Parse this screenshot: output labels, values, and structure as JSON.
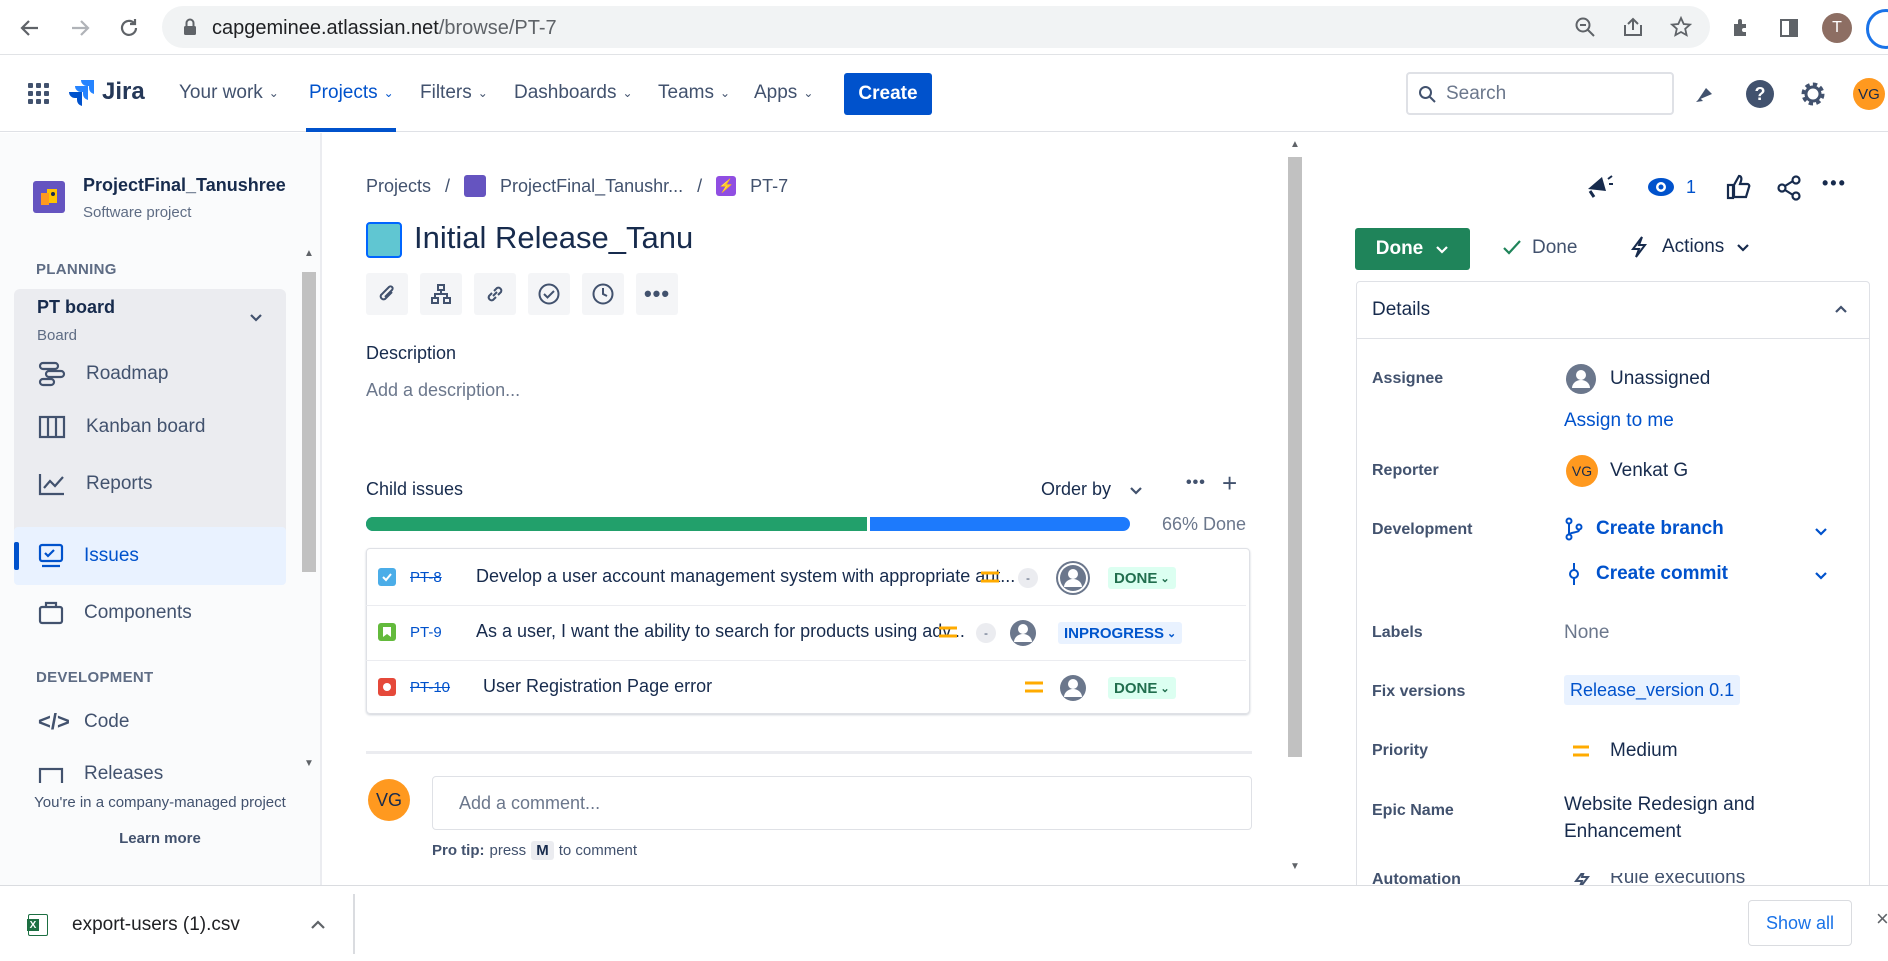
{
  "browser": {
    "url_host": "capgeminee.atlassian.net",
    "url_path": "/browse/PT-7",
    "profile_initial": "T"
  },
  "nav": {
    "product": "Jira",
    "items": [
      "Your work",
      "Projects",
      "Filters",
      "Dashboards",
      "Teams",
      "Apps"
    ],
    "create_label": "Create",
    "search_placeholder": "Search",
    "avatar_initials": "VG"
  },
  "sidebar": {
    "project_name": "ProjectFinal_Tanushree",
    "project_type": "Software project",
    "planning_title": "PLANNING",
    "board_name": "PT board",
    "board_sub": "Board",
    "items": [
      "Roadmap",
      "Kanban board",
      "Reports",
      "Issues",
      "Components"
    ],
    "development_title": "DEVELOPMENT",
    "dev_items": [
      "Code",
      "Releases"
    ],
    "footer_text": "You're in a company-managed project",
    "learn_more": "Learn more"
  },
  "issue": {
    "breadcrumb": [
      "Projects",
      "ProjectFinal_Tanushr...",
      "PT-7"
    ],
    "title": "Initial Release_Tanu",
    "description_label": "Description",
    "description_placeholder": "Add a description...",
    "child_issues_label": "Child issues",
    "order_by_label": "Order by",
    "progress_label": "66% Done",
    "progress_done_fraction": 0.66,
    "children": [
      {
        "key": "PT-8",
        "summary": "Develop a user account management system with appropriate aut...",
        "status": "DONE",
        "type": "task"
      },
      {
        "key": "PT-9",
        "summary": "As a user, I want the ability to search for products using adv...",
        "status": "INPROGRESS",
        "type": "story"
      },
      {
        "key": "PT-10",
        "summary": "User Registration Page error",
        "status": "DONE",
        "type": "bug"
      }
    ],
    "child_estimate": "-",
    "comment_avatar": "VG",
    "comment_placeholder": "Add a comment...",
    "pro_tip_bold": "Pro tip:",
    "pro_tip_press": "press",
    "pro_tip_key": "M",
    "pro_tip_rest": "to comment"
  },
  "right": {
    "watchers_count": "1",
    "status_button": "Done",
    "resolution": "Done",
    "actions_label": "Actions",
    "details_title": "Details",
    "assignee_label": "Assignee",
    "assignee_value": "Unassigned",
    "assign_to_me": "Assign to me",
    "reporter_label": "Reporter",
    "reporter_initials": "VG",
    "reporter_value": "Venkat G",
    "development_label": "Development",
    "create_branch": "Create branch",
    "create_commit": "Create commit",
    "labels_label": "Labels",
    "labels_value": "None",
    "fix_versions_label": "Fix versions",
    "fix_versions_value": "Release_version 0.1",
    "priority_label": "Priority",
    "priority_value": "Medium",
    "epic_name_label": "Epic Name",
    "epic_name_line1": "Website Redesign and",
    "epic_name_line2": "Enhancement",
    "automation_label": "Automation",
    "automation_value": "Rule executions"
  },
  "downloads": {
    "file_name": "export-users (1).csv",
    "show_all": "Show all"
  },
  "colors": {
    "brand_blue": "#0052cc",
    "done_green": "#1f845a",
    "progress_green": "#22a06b",
    "progress_blue": "#1d7afc",
    "avatar_orange": "#ff991f"
  }
}
